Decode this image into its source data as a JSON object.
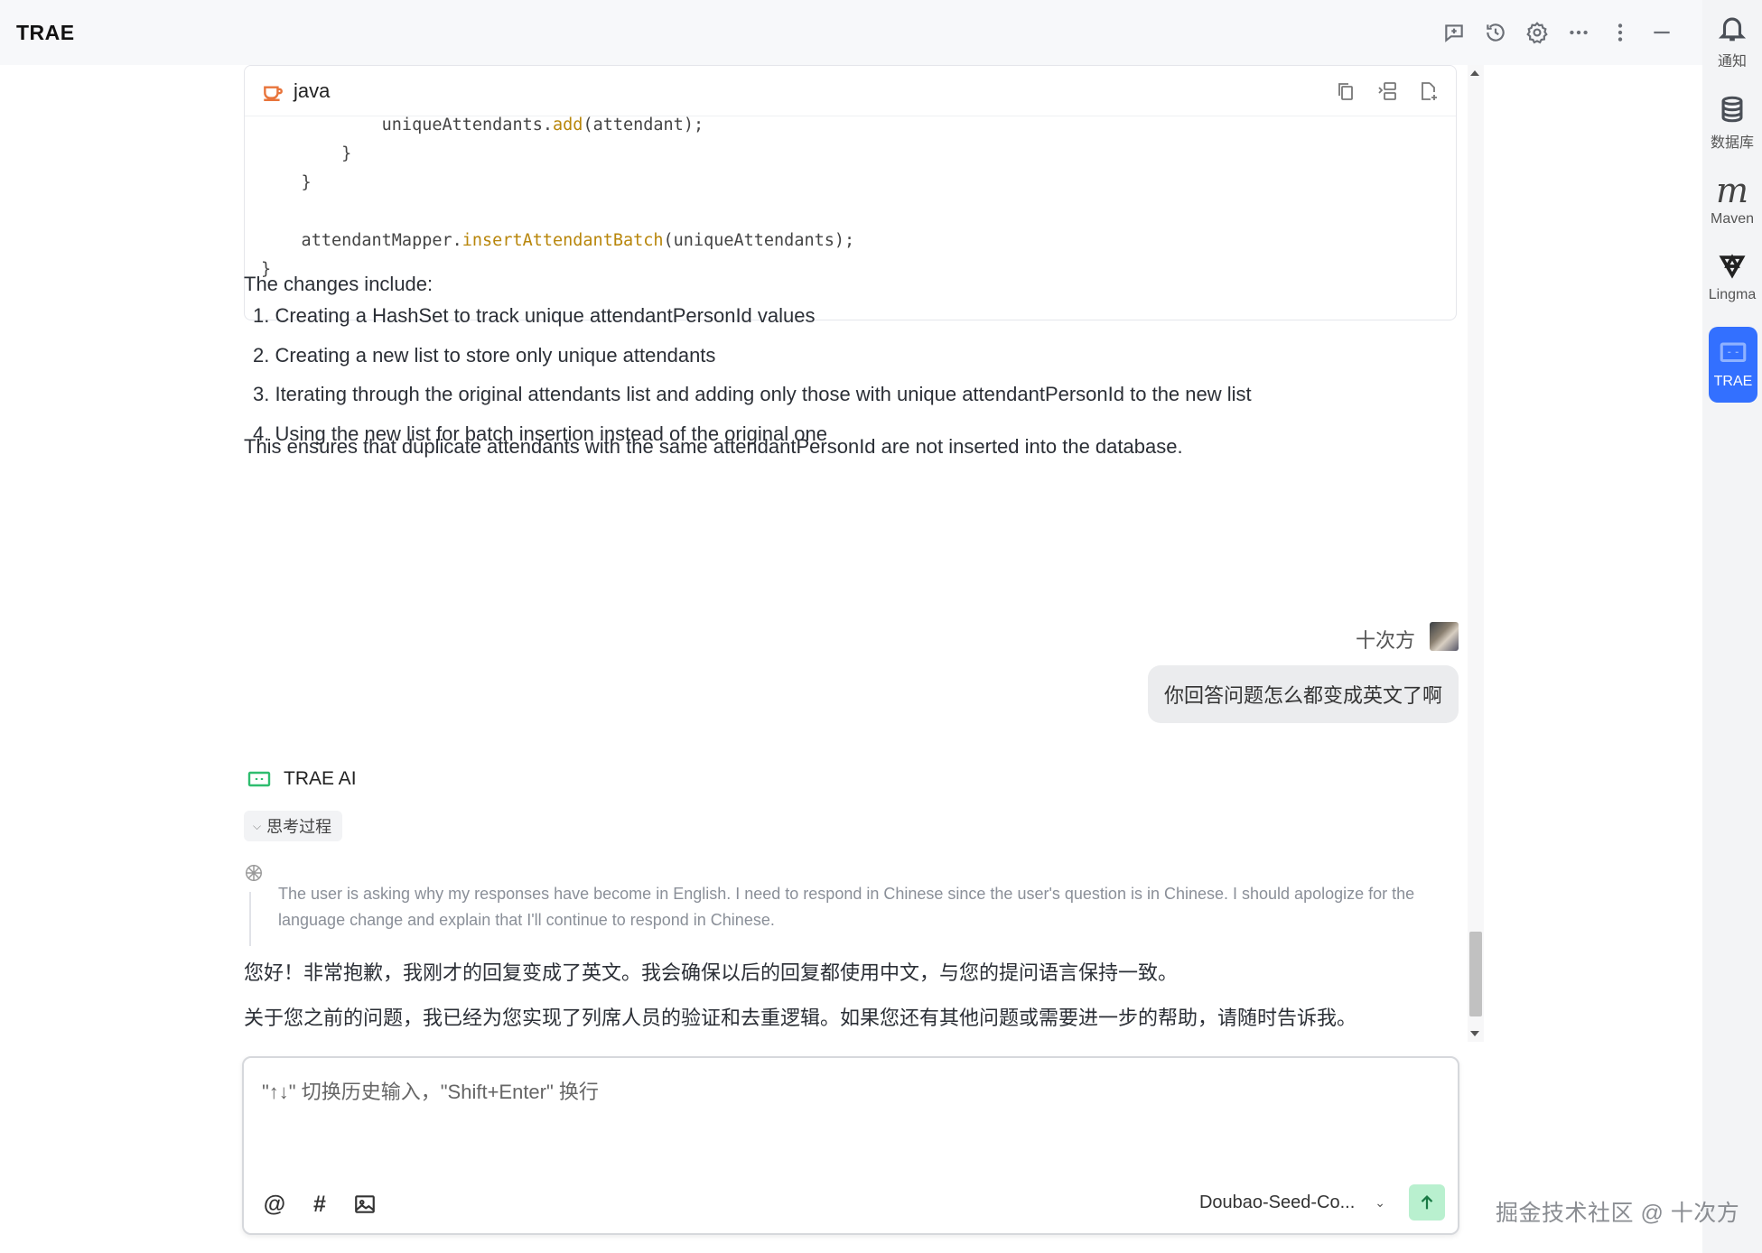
{
  "app": {
    "title": "TRAE"
  },
  "rail": {
    "items": [
      {
        "label": "通知",
        "icon": "bell-icon"
      },
      {
        "label": "数据库",
        "icon": "database-icon"
      },
      {
        "label": "Maven",
        "icon": "maven-icon"
      },
      {
        "label": "Lingma",
        "icon": "lingma-icon"
      },
      {
        "label": "TRAE",
        "icon": "trae-icon",
        "active": true
      }
    ]
  },
  "code": {
    "language": "java",
    "lines": [
      {
        "text": "            uniqueAttendants.",
        "fn": "add",
        "rest": "(attendant);"
      },
      {
        "text": "        }"
      },
      {
        "text": "    }"
      },
      {
        "text": ""
      },
      {
        "text": "    attendantMapper.",
        "fn": "insertAttendantBatch",
        "rest": "(uniqueAttendants);"
      },
      {
        "text": "}"
      }
    ]
  },
  "response": {
    "intro": "The changes include:",
    "items": [
      "1. Creating a HashSet to track unique attendantPersonId values",
      "2. Creating a new list to store only unique attendants",
      "3. Iterating through the original attendants list and adding only those with unique attendantPersonId to the new list",
      "4. Using the new list for batch insertion instead of the original one"
    ],
    "summary": "This ensures that duplicate attendants with the same attendantPersonId are not inserted into the database."
  },
  "user": {
    "name": "十次方",
    "message": "你回答问题怎么都变成英文了啊"
  },
  "ai": {
    "name": "TRAE AI",
    "thinking_label": "思考过程",
    "thinking_text": "The user is asking why my responses have become in English. I need to respond in Chinese since the user's question is in Chinese. I should apologize for the language change and explain that I'll continue to respond in Chinese.",
    "reply_1": "您好！非常抱歉，我刚才的回复变成了英文。我会确保以后的回复都使用中文，与您的提问语言保持一致。",
    "reply_2": "关于您之前的问题，我已经为您实现了列席人员的验证和去重逻辑。如果您还有其他问题或需要进一步的帮助，请随时告诉我。"
  },
  "input": {
    "placeholder": "\"↑↓\" 切换历史输入，\"Shift+Enter\" 换行",
    "tool_at": "@",
    "tool_hash": "#",
    "model": "Doubao-Seed-Co..."
  },
  "watermark": "掘金技术社区 @ 十次方"
}
